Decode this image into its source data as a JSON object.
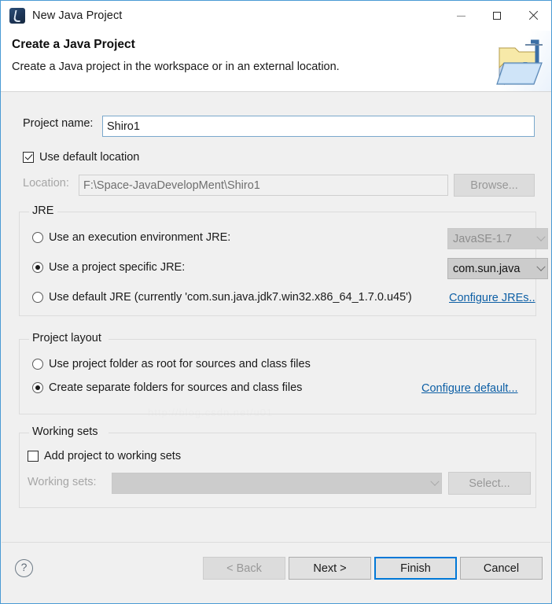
{
  "window": {
    "title": "New Java Project",
    "icon": "java-project-icon",
    "controls": {
      "minimize": "minimize-icon",
      "maximize": "maximize-icon",
      "close": "close-icon"
    }
  },
  "banner": {
    "title": "Create a Java Project",
    "subtitle": "Create a Java project in the workspace or in an external location.",
    "icon": "java-project-folder-icon"
  },
  "project": {
    "name_label": "Project name:",
    "name_value": "Shiro1",
    "use_default_location_label": "Use default location",
    "use_default_location_checked": true,
    "location_label": "Location:",
    "location_value": "F:\\Space-JavaDevelopMent\\Shiro1",
    "location_enabled": false,
    "browse_label": "Browse...",
    "browse_enabled": false
  },
  "jre": {
    "group_label": "JRE",
    "options": [
      {
        "label": "Use an execution environment JRE:",
        "selected": false,
        "combo_value": "JavaSE-1.7",
        "combo_enabled": false
      },
      {
        "label": "Use a project specific JRE:",
        "selected": true,
        "combo_value": "com.sun.java",
        "combo_enabled": true
      },
      {
        "label": "Use default JRE (currently 'com.sun.java.jdk7.win32.x86_64_1.7.0.u45')",
        "selected": false
      }
    ],
    "configure_link": "Configure JREs.."
  },
  "project_layout": {
    "group_label": "Project layout",
    "options": [
      {
        "label": "Use project folder as root for sources and class files",
        "selected": false
      },
      {
        "label": "Create separate folders for sources and class files",
        "selected": true
      }
    ],
    "configure_link": "Configure default..."
  },
  "working_sets": {
    "group_label": "Working sets",
    "add_label": "Add project to working sets",
    "add_checked": false,
    "sets_label": "Working sets:",
    "sets_value": "",
    "sets_enabled": false,
    "select_label": "Select...",
    "select_enabled": false
  },
  "footer": {
    "help_icon": "?",
    "buttons": [
      {
        "label": "< Back",
        "enabled": false,
        "default": false
      },
      {
        "label": "Next >",
        "enabled": true,
        "default": false
      },
      {
        "label": "Finish",
        "enabled": true,
        "default": true
      },
      {
        "label": "Cancel",
        "enabled": true,
        "default": false
      }
    ]
  },
  "colors": {
    "window_border": "#4a9ad4",
    "body": "#f0f0f0",
    "accent": "#0078d7",
    "link": "#0d5fa5"
  }
}
